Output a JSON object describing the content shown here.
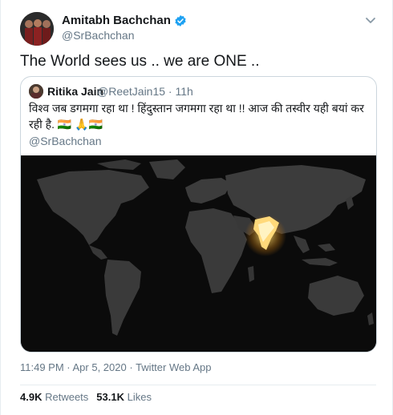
{
  "author": {
    "name": "Amitabh Bachchan",
    "handle": "@SrBachchan",
    "verified": true
  },
  "tweet": {
    "text": "The World sees us .. we are ONE .."
  },
  "quote": {
    "name": "Ritika Jain",
    "handle": "@ReetJain15 · 11h",
    "text": "विश्व जब डगमगा रहा था ! हिंदुस्तान जगमगा रहा था !! आज की तस्वीर यही बयां कर रही है. 🇮🇳 🙏🇮🇳",
    "mention": "@SrBachchan"
  },
  "meta": {
    "time": "11:49 PM · Apr 5, 2020 ·",
    "app": "Twitter Web App"
  },
  "stats": {
    "retweets_count": "4.9K",
    "retweets_label": "Retweets",
    "likes_count": "53.1K",
    "likes_label": "Likes"
  },
  "colors": {
    "verified": "#1da1f2",
    "muted": "#657786",
    "land": "#3c3c3c",
    "glow": "#ffcc55"
  }
}
